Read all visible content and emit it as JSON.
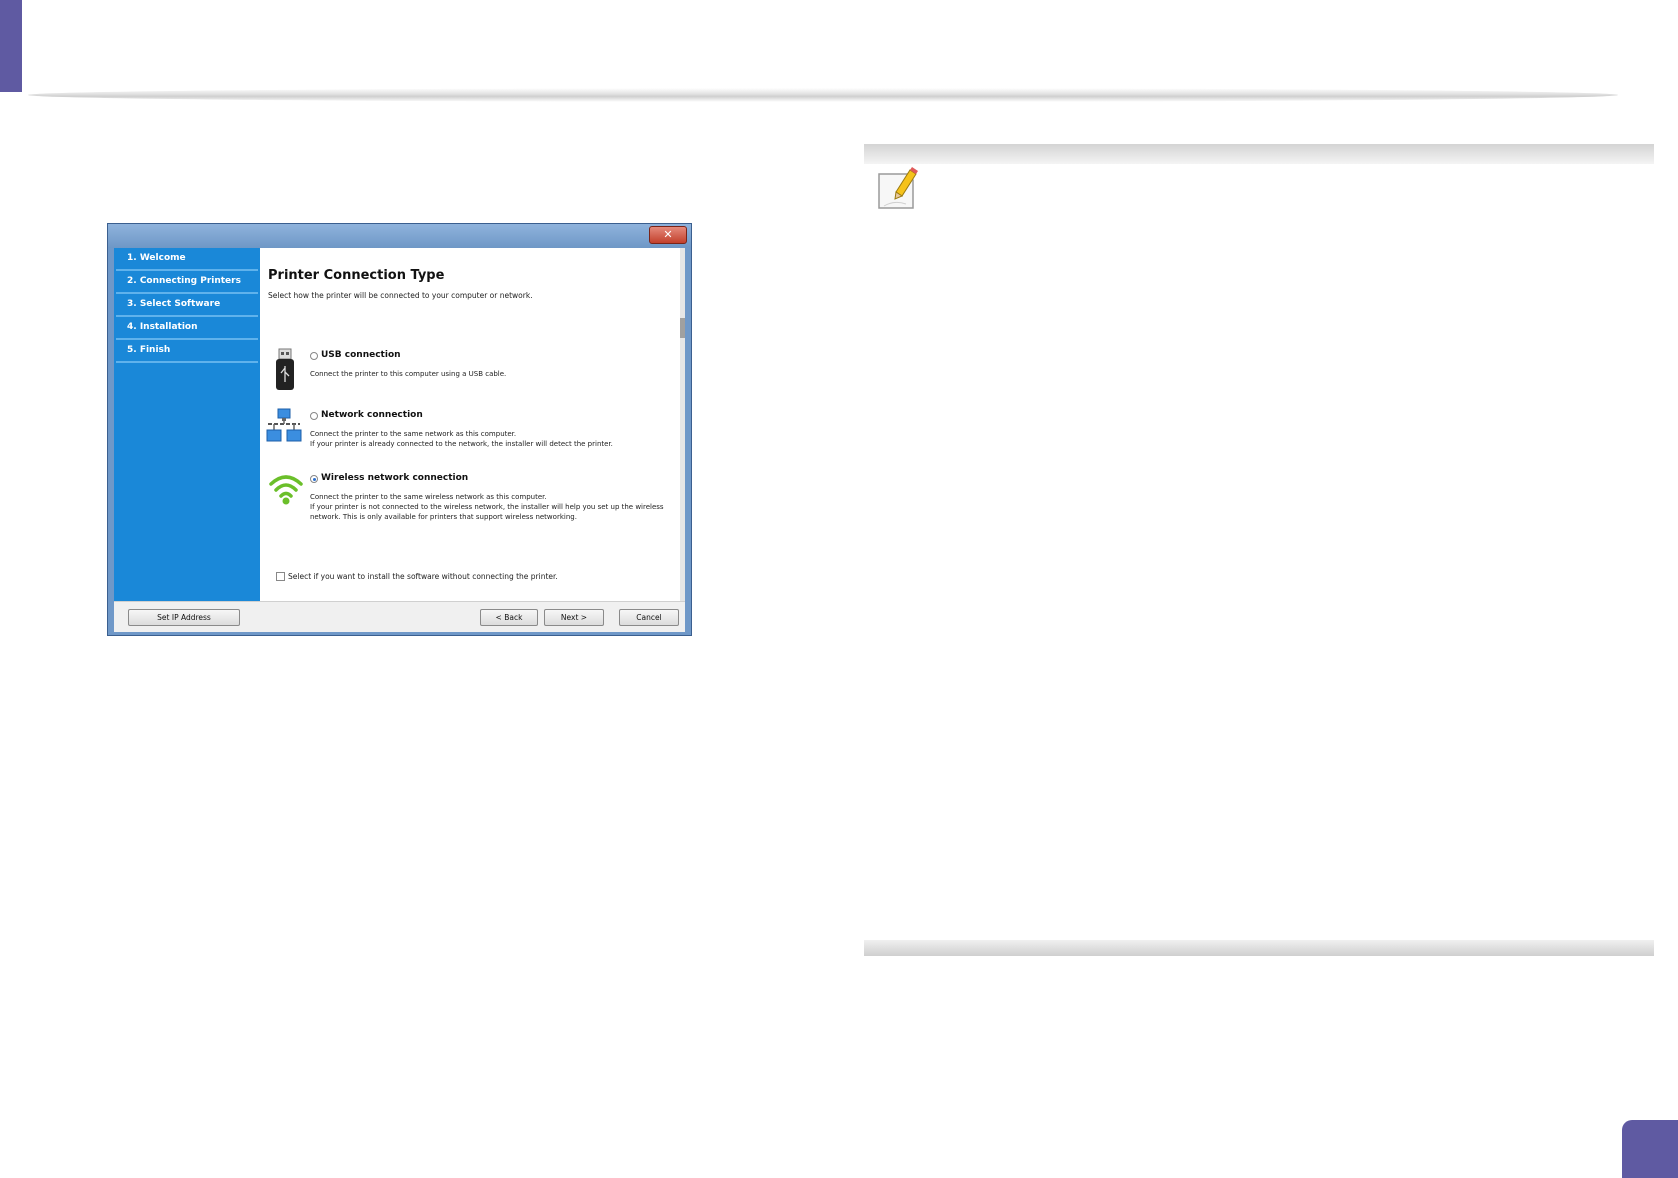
{
  "dialog": {
    "close_glyph": "✕",
    "steps": [
      {
        "label": "1. Welcome"
      },
      {
        "label": "2. Connecting Printers"
      },
      {
        "label": "3. Select Software"
      },
      {
        "label": "4. Installation"
      },
      {
        "label": "5. Finish"
      }
    ],
    "title": "Printer Connection Type",
    "subtitle": "Select how the printer will be connected to your computer or network.",
    "options": [
      {
        "label": "USB connection",
        "description": "Connect the printer to this computer using a USB cable.",
        "selected": false,
        "icon": "usb-icon"
      },
      {
        "label": "Network connection",
        "description": "Connect the printer to the same network as this computer.\nIf your printer is already connected to the network, the installer will detect the printer.",
        "selected": false,
        "icon": "network-icon"
      },
      {
        "label": "Wireless network connection",
        "description": "Connect the printer to the same wireless network as this computer.\nIf your printer is not connected to the wireless network, the installer will help you set up the wireless network. This is only available for printers that support wireless networking.",
        "selected": true,
        "icon": "wifi-icon"
      }
    ],
    "skip_checkbox_label": "Select if you want to install the software without connecting the printer.",
    "buttons": {
      "set_ip": "Set IP Address",
      "back": "< Back",
      "next": "Next >",
      "cancel": "Cancel"
    }
  },
  "note": {
    "icon": "note-pencil-icon"
  },
  "colors": {
    "accent": "#5f5aa2",
    "steps_panel": "#1a88d8"
  }
}
